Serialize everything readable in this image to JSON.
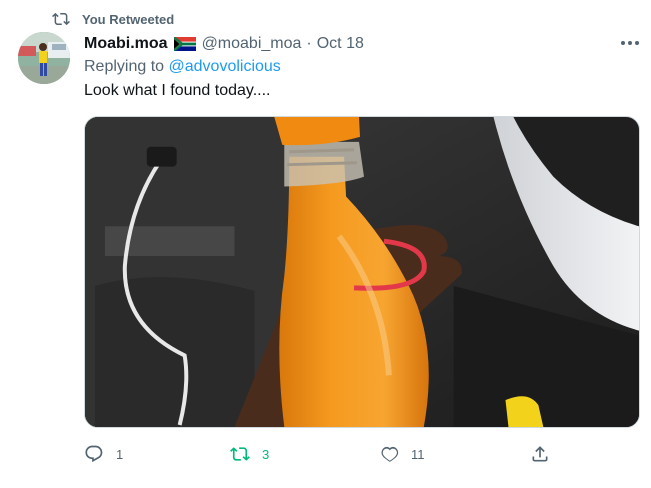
{
  "retweet_context": {
    "label": "You Retweeted"
  },
  "author": {
    "name": "Moabi.moa",
    "handle": "@moabi_moa",
    "separator": "·",
    "time": "Oct 18",
    "flag": "south-africa-flag"
  },
  "reply": {
    "prefix": "Replying to",
    "mention": "@advovolicious"
  },
  "tweet": {
    "text": "Look what I found today...."
  },
  "media": {
    "description_icon": "photo-orange-juice-bottle"
  },
  "actions": {
    "reply_count": "1",
    "retweet_count": "3",
    "like_count": "11"
  },
  "colors": {
    "accent": "#1d9bf0",
    "retweet_active": "#00ba7c",
    "muted": "#536471"
  }
}
